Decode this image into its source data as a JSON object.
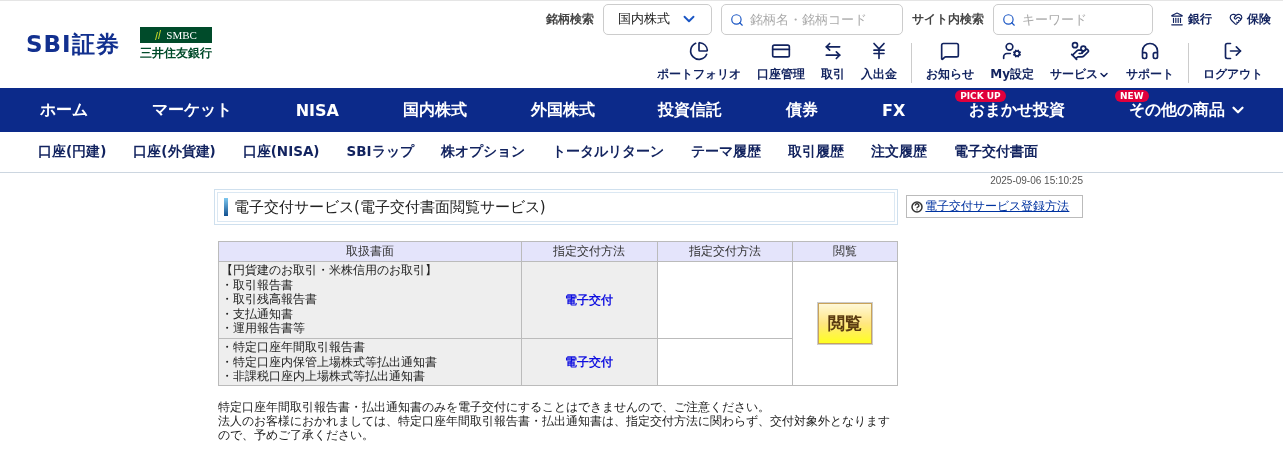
{
  "header": {
    "logo": "SBI証券",
    "partner_logo": {
      "mark": "SMBC",
      "name": "三井住友銀行"
    },
    "stock_search": {
      "label": "銘柄検索",
      "market_select": "国内株式",
      "placeholder": "銘柄名・銘柄コード"
    },
    "site_search": {
      "label": "サイト内検索",
      "placeholder": "キーワード"
    },
    "top_links": [
      "銀行",
      "保険"
    ],
    "tools": [
      {
        "label": "ポートフォリオ",
        "separator": false
      },
      {
        "label": "口座管理",
        "separator": false
      },
      {
        "label": "取引",
        "separator": false
      },
      {
        "label": "入出金",
        "separator": false
      },
      {
        "label": "お知らせ",
        "separator": true
      },
      {
        "label": "My設定",
        "separator": false
      },
      {
        "label": "サービス",
        "separator": false,
        "dropdown": true
      },
      {
        "label": "サポート",
        "separator": false
      },
      {
        "label": "ログアウト",
        "separator": true
      }
    ]
  },
  "main_nav": [
    {
      "label": "ホーム"
    },
    {
      "label": "マーケット"
    },
    {
      "label": "NISA"
    },
    {
      "label": "国内株式"
    },
    {
      "label": "外国株式"
    },
    {
      "label": "投資信託"
    },
    {
      "label": "債券"
    },
    {
      "label": "FX"
    },
    {
      "label": "おまかせ投資",
      "badge": "PICK UP"
    },
    {
      "label": "その他の商品",
      "badge": "NEW",
      "dropdown": true
    }
  ],
  "sub_nav": [
    "口座(円建)",
    "口座(外貨建)",
    "口座(NISA)",
    "SBIラップ",
    "株オプション",
    "トータルリターン",
    "テーマ履歴",
    "取引履歴",
    "注文履歴",
    "電子交付書面"
  ],
  "timestamp": "2025-09-06 15:10:25",
  "page_title": "電子交付サービス(電子交付書面閲覧サービス)",
  "help_link": "電子交付サービス登録方法",
  "table": {
    "columns": [
      "取扱書面",
      "指定交付方法",
      "指定交付方法",
      "閲覧"
    ],
    "rows": [
      {
        "documents": [
          "【円貨建のお取引・米株信用のお取引】",
          "・取引報告書",
          "・取引残高報告書",
          "・支払通知書",
          "・運用報告書等"
        ],
        "method": "電子交付"
      },
      {
        "documents": [
          "・特定口座年間取引報告書",
          "・特定口座内保管上場株式等払出通知書",
          "・非課税口座内上場株式等払出通知書"
        ],
        "method": "電子交付"
      }
    ],
    "view_button": "閲覧"
  },
  "notes": [
    "特定口座年間取引報告書・払出通知書のみを電子交付にすることはできませんので、ご注意ください。",
    "法人のお客様におかれましては、特定口座年間取引報告書・払出通知書は、指定交付方法に関わらず、交付対象外となりますので、予めご了承ください。"
  ]
}
